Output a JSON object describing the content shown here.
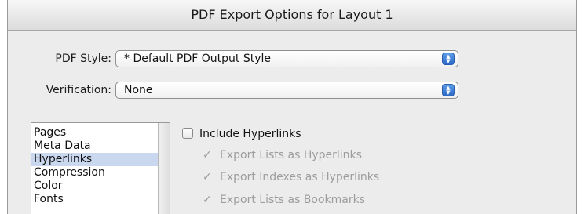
{
  "window": {
    "title": "PDF Export Options for Layout 1"
  },
  "fields": {
    "pdf_style": {
      "label": "PDF Style:",
      "value": "* Default PDF Output Style"
    },
    "verification": {
      "label": "Verification:",
      "value": "None"
    }
  },
  "list": {
    "items": [
      "Pages",
      "Meta Data",
      "Hyperlinks",
      "Compression",
      "Color",
      "Fonts"
    ],
    "selected_item": "Hyperlinks"
  },
  "hyperlinks": {
    "include_label": "Include Hyperlinks",
    "include_checked": false,
    "options": [
      {
        "label": "Export Lists as Hyperlinks",
        "checked": true,
        "enabled": false
      },
      {
        "label": "Export Indexes as Hyperlinks",
        "checked": true,
        "enabled": false
      },
      {
        "label": "Export Lists as Bookmarks",
        "checked": true,
        "enabled": false
      }
    ]
  },
  "icons": {
    "popup_arrows": "updown-arrows-icon",
    "checkmark": "checkmark-icon"
  },
  "colors": {
    "popup_accent": "#2c6ac8",
    "list_selection": "#c9d8ee"
  }
}
